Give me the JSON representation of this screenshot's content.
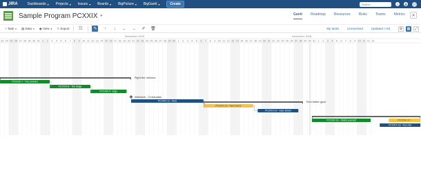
{
  "topnav": {
    "logo": "JIRA",
    "items": [
      "Dashboards",
      "Projects",
      "Issues",
      "Boards",
      "BigPicture",
      "BigGantt"
    ],
    "create": "Create",
    "search_placeholder": "Search",
    "help": "?"
  },
  "project": {
    "title": "Sample Program PCXXIX"
  },
  "tabs": [
    "Gantt",
    "Roadmap",
    "Resources",
    "Risks",
    "Teams",
    "Metrics"
  ],
  "toolbar": {
    "task": "Task",
    "data": "Data",
    "view": "View",
    "export": "Export",
    "my_tasks": "My tasks",
    "unresolved": "Unresolved",
    "updated": "Updated < 5d"
  },
  "timeline": {
    "months": [
      {
        "label": "November 2018"
      },
      {
        "label": "December 2018"
      }
    ],
    "days": [
      "23",
      "24",
      "25",
      "26",
      "27",
      "28",
      "29",
      "30",
      "31",
      "1",
      "2",
      "3",
      "4",
      "5",
      "6",
      "7",
      "8",
      "9",
      "10",
      "11",
      "12",
      "13",
      "14",
      "15",
      "16",
      "17",
      "18",
      "19",
      "20",
      "21",
      "22",
      "23",
      "24",
      "25",
      "26",
      "27",
      "28",
      "29",
      "30",
      "1",
      "2",
      "3",
      "4",
      "5",
      "6",
      "7",
      "8",
      "9",
      "10",
      "11",
      "12",
      "13",
      "14",
      "15",
      "16",
      "17",
      "18",
      "19",
      "20",
      "21",
      "22",
      "23",
      "24",
      "25",
      "26",
      "27",
      "28",
      "29",
      "30",
      "31",
      "1",
      "2",
      "3",
      "4",
      "5",
      "6",
      "7",
      "8",
      "9",
      "10",
      "11",
      "12",
      "13"
    ],
    "weekend_idx": [
      2,
      3,
      9,
      10,
      16,
      17,
      23,
      24,
      30,
      31,
      37,
      38,
      44,
      45,
      51,
      52,
      58,
      59,
      65,
      66,
      72,
      73,
      79,
      80
    ],
    "bars": [
      {
        "id": "PCXXIX-7 - The contract",
        "color": "#14892c",
        "start": 0,
        "end": 11,
        "row": 0
      },
      {
        "id": "PCXXIX-8 - The fudge",
        "color": "#14892c",
        "start": 11,
        "end": 20,
        "row": 1
      },
      {
        "id": "PCXXIX-9 - Ergo",
        "color": "#14892c",
        "start": 20,
        "end": 28,
        "row": 2
      },
      {
        "id": "PCXXIX-11 - Kind",
        "color": "#205081",
        "start": 29,
        "end": 45,
        "row": 4
      },
      {
        "id": "PCXXIX-13 - New sword",
        "color": "#f6c342",
        "start": 45,
        "end": 56,
        "row": 5
      },
      {
        "id": "PCXXIX-14 - User shield",
        "color": "#205081",
        "start": 57,
        "end": 66,
        "row": 6
      },
      {
        "id": "PCXXIX-16 - Shield yourself",
        "color": "#14892c",
        "start": 69,
        "end": 82,
        "row": 8
      },
      {
        "id": "PCXXIX-17 -",
        "color": "#f6c342",
        "start": 86,
        "end": 93,
        "row": 8
      },
      {
        "id": "PCXXIX-18 - Run mid",
        "color": "#205081",
        "start": 84,
        "end": 93,
        "row": 9
      }
    ],
    "groups": [
      {
        "label": "Fight the minions",
        "start": 0,
        "end": 29,
        "row": -1
      },
      {
        "label": "Find better gear",
        "start": 45,
        "end": 67,
        "row": 4
      },
      {
        "label": "",
        "start": 69,
        "end": 93,
        "row": 7
      }
    ],
    "milestones": [
      {
        "label": "milestone - Crossroads",
        "at": 29,
        "row": 3
      }
    ]
  }
}
